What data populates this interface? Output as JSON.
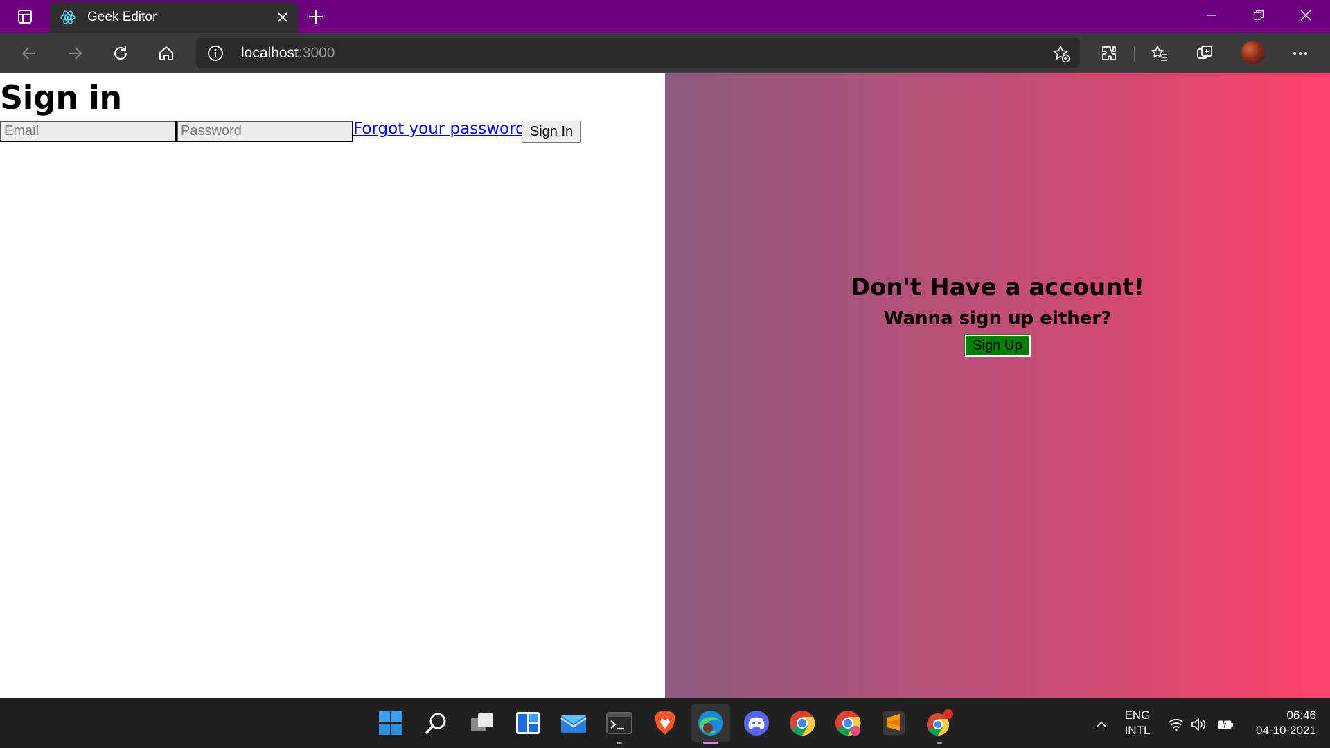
{
  "browser": {
    "tab_title": "Geek Editor",
    "address_host": "localhost",
    "address_port": ":3000"
  },
  "page": {
    "signin_title": "Sign in",
    "email_placeholder": "Email",
    "password_placeholder": "Password",
    "forgot_link": "Forgot your password?",
    "signin_button": "Sign In",
    "overlay_title": "Don't Have a account!",
    "overlay_subtitle": "Wanna sign up either?",
    "signup_button": "Sign Up"
  },
  "taskbar": {
    "apps": [
      "start-icon",
      "search-icon",
      "task-view-icon",
      "widgets-icon",
      "mail-icon",
      "terminal-icon",
      "brave-icon",
      "edge-icon",
      "discord-icon",
      "chrome-icon",
      "chrome-profile-icon",
      "sublime-text-icon",
      "chrome-app-icon"
    ],
    "language_top": "ENG",
    "language_bottom": "INTL",
    "time": "06:46",
    "date": "04-10-2021"
  },
  "colors": {
    "titlebar": "#6a0080",
    "toolbar": "#3b3b3b",
    "gradient_start": "#8b5a7d",
    "gradient_end": "#ff416c",
    "signup_button": "#008000",
    "link": "#0000ee",
    "taskbar": "#202020"
  }
}
